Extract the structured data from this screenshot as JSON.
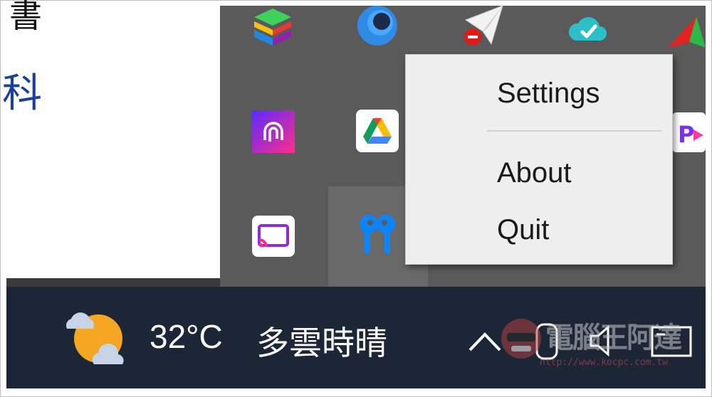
{
  "document": {
    "fragment_top": "書",
    "fragment_left": "科"
  },
  "tray_icons": [
    {
      "name": "bluestacks-icon"
    },
    {
      "name": "orb-app-icon"
    },
    {
      "name": "paper-plane-blocked-icon"
    },
    {
      "name": "cloud-check-icon"
    },
    {
      "name": "red-triangle-app-icon"
    },
    {
      "name": "fingerprint-app-icon"
    },
    {
      "name": "google-drive-icon"
    },
    {
      "name": "pj-app-icon"
    },
    {
      "name": "cast-icon"
    },
    {
      "name": "airpods-icon"
    }
  ],
  "context_menu": {
    "settings_label": "Settings",
    "about_label": "About",
    "quit_label": "Quit"
  },
  "taskbar": {
    "temperature": "32°C",
    "condition": "多雲時晴"
  },
  "watermark": {
    "text": "電腦王阿達",
    "url": "http://www.kocpc.com.tw"
  },
  "colors": {
    "tray_bg": "#5a5a5a",
    "taskbar_bg": "#1d2637",
    "menu_bg": "#eeeeee",
    "airpods_blue": "#0a84ff"
  }
}
